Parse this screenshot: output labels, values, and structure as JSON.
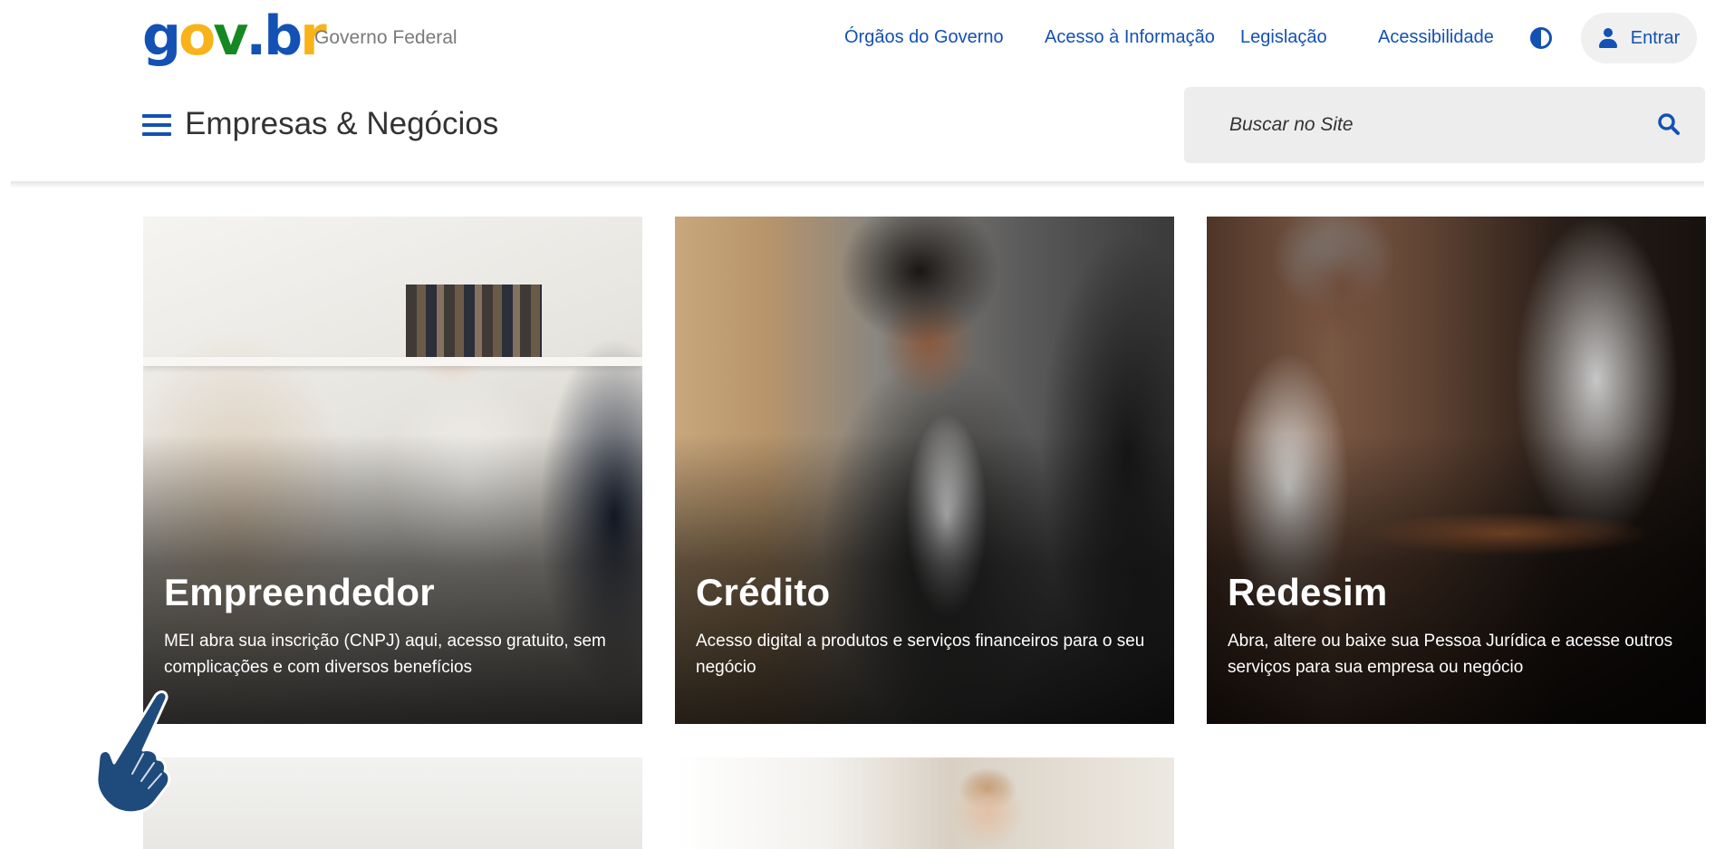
{
  "header": {
    "logo": {
      "g": "g",
      "o": "o",
      "v": "v",
      "dot": ".",
      "b": "b",
      "r": "r"
    },
    "gov_label": "Governo Federal",
    "links": [
      {
        "label": "Órgãos do Governo"
      },
      {
        "label": "Acesso à Informação"
      },
      {
        "label": "Legislação"
      },
      {
        "label": "Acessibilidade"
      }
    ],
    "contrast_icon": "contrast-icon",
    "login": {
      "label": "Entrar",
      "icon": "user-icon"
    },
    "site_title": "Empresas & Negócios",
    "menu_icon": "hamburger-menu-icon",
    "search": {
      "placeholder": "Buscar no Site",
      "icon": "search-icon"
    }
  },
  "cards": [
    {
      "title": "Empreendedor",
      "description": "MEI abra sua inscrição (CNPJ) aqui, acesso gratuito, sem complicações e com diversos benefícios"
    },
    {
      "title": "Crédito",
      "description": "Acesso digital a produtos e serviços financeiros para o seu negócio"
    },
    {
      "title": "Redesim",
      "description": "Abra, altere ou baixe sua Pessoa Jurídica e acesse outros serviços para sua empresa ou negócio"
    }
  ],
  "colors": {
    "primary_blue": "#1351b4",
    "logo_yellow": "#f8b31a",
    "logo_green": "#168821",
    "pointer_blue": "#1f4a7c"
  },
  "pointer": {
    "icon": "pointing-hand-icon"
  }
}
